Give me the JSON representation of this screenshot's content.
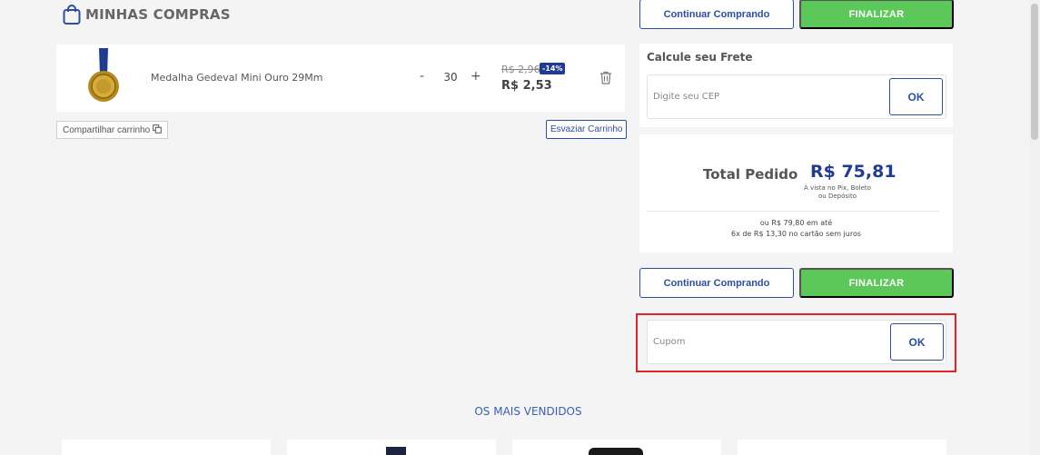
{
  "header": {
    "title": "MINHAS COMPRAS",
    "icon": "shopping-bag-icon"
  },
  "cart": {
    "items": [
      {
        "name": "Medalha Gedeval Mini Ouro 29Mm",
        "quantity": "30",
        "qty_minus": "-",
        "qty_plus": "+",
        "price_old": "R$ 2,96",
        "discount": "-14%",
        "price_new": "R$ 2,53"
      }
    ],
    "share_label": "Compartilhar carrinho",
    "clear_label": "Esvaziar Carrinho"
  },
  "actions": {
    "continue_label": "Continuar Comprando",
    "finalize_label": "FINALIZAR"
  },
  "freight": {
    "title": "Calcule seu Frete",
    "placeholder": "Digite seu CEP",
    "ok_label": "OK"
  },
  "total": {
    "label": "Total Pedido",
    "value": "R$ 75,81",
    "note_line1": "À vista no Pix, Boleto",
    "note_line2": "ou Depósito",
    "installment_line1": "ou R$ 79,80 em até",
    "installment_line2": "6x de R$ 13,30 no cartão sem juros"
  },
  "coupon": {
    "placeholder": "Cupom",
    "ok_label": "OK"
  },
  "best_sellers": {
    "title": "OS MAIS VENDIDOS"
  },
  "colors": {
    "accent_blue": "#2d4ea6",
    "finalize_green": "#5cc85a",
    "highlight_red": "#e0232b",
    "background": "#f5f4f4"
  }
}
